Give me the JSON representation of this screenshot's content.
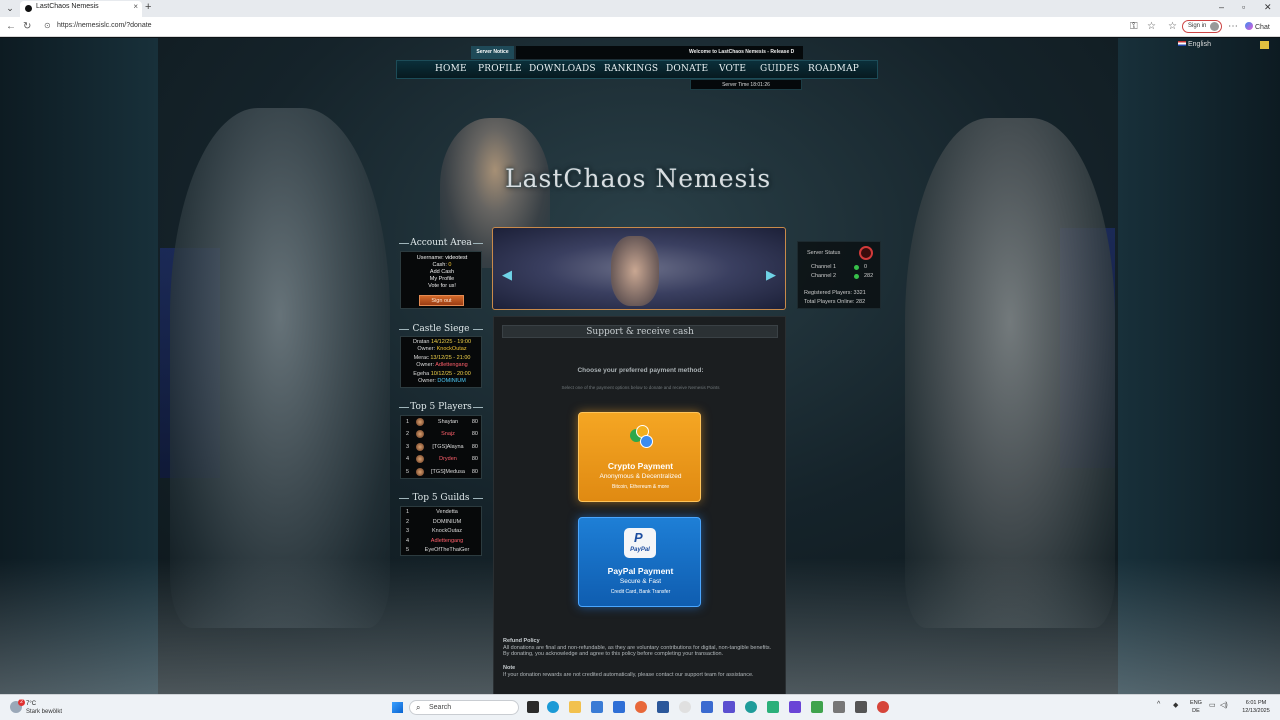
{
  "browser": {
    "tab_title": "LastChaos Nemesis",
    "url": "https://nemesislc.com/?donate",
    "signin_label": "Sign in",
    "chat_label": "Chat"
  },
  "page": {
    "language": "English",
    "notice_label": "Server Notice",
    "notice_text": "Welcome to LastChaos Nemesis - Release D",
    "nav": [
      "HOME",
      "PROFILE",
      "DOWNLOADS",
      "RANKINGS",
      "DONATE",
      "VOTE",
      "GUIDES",
      "ROADMAP"
    ],
    "server_time": "Server Time 18:01:26",
    "logo_text": "LastChaos Nemesis"
  },
  "account": {
    "title": "Account Area",
    "username_label": "Username:",
    "username": "videotest",
    "cash_label": "Cash:",
    "cash": "0",
    "links": [
      "Add Cash",
      "My Profile",
      "Vote for us!"
    ],
    "signout": "Sign out"
  },
  "siege": {
    "title": "Castle Siege",
    "entries": [
      {
        "castle": "Dratan",
        "date": "14/12/25 - 19:00",
        "owner_label": "Owner:",
        "owner": "KnockOutaz"
      },
      {
        "castle": "Merac",
        "date": "13/12/25 - 21:00",
        "owner_label": "Owner:",
        "owner": "Adlettengang"
      },
      {
        "castle": "Egeha",
        "date": "10/12/25 - 20:00",
        "owner_label": "Owner:",
        "owner": "DOMINIUM"
      }
    ]
  },
  "top_players": {
    "title": "Top 5 Players",
    "rows": [
      {
        "rank": "1",
        "name": "Shaytan",
        "level": "80"
      },
      {
        "rank": "2",
        "name": "Snajz",
        "level": "80"
      },
      {
        "rank": "3",
        "name": "[TGS]Alayna",
        "level": "80"
      },
      {
        "rank": "4",
        "name": "Dryden",
        "level": "80"
      },
      {
        "rank": "5",
        "name": "[TGS]Medusa",
        "level": "80"
      }
    ]
  },
  "top_guilds": {
    "title": "Top 5 Guilds",
    "rows": [
      {
        "rank": "1",
        "name": "Vendetta"
      },
      {
        "rank": "2",
        "name": "DOMINIUM"
      },
      {
        "rank": "3",
        "name": "KnockOutaz"
      },
      {
        "rank": "4",
        "name": "Adlettengang"
      },
      {
        "rank": "5",
        "name": "EyeOfTheThaiGer"
      }
    ]
  },
  "donate": {
    "heading": "Support & receive cash",
    "choose": "Choose your preferred payment method:",
    "choose_sub": "Select one of the payment options below to donate and receive Nemesis Points",
    "crypto": {
      "title": "Crypto Payment",
      "subtitle": "Anonymous & Decentralized",
      "detail": "Bitcoin, Ethereum & more"
    },
    "paypal": {
      "title": "PayPal Payment",
      "subtitle": "Secure & Fast",
      "detail": "Credit Card, Bank Transfer",
      "logo_text": "PayPal"
    },
    "refund_title": "Refund Policy",
    "refund_text": "All donations are final and non-refundable, as they are voluntary contributions for digital, non-tangible benefits. By donating, you acknowledge and agree to this policy before completing your transaction.",
    "note_title": "Note",
    "note_text": "If your donation rewards are not credited automatically, please contact our support team for assistance."
  },
  "server_status": {
    "title": "Server Status",
    "channel1_label": "Channel 1",
    "channel1_value": "0",
    "channel2_label": "Channel 2",
    "channel2_value": "282",
    "registered": "Registered Players: 3321",
    "online": "Total Players Online: 282"
  },
  "taskbar": {
    "temp": "7°C",
    "condition": "Stark bewölkt",
    "weather_badge": "2",
    "search": "Search",
    "lang_top": "ENG",
    "lang_bottom": "DE",
    "time": "6:01 PM",
    "date": "12/13/2025"
  }
}
